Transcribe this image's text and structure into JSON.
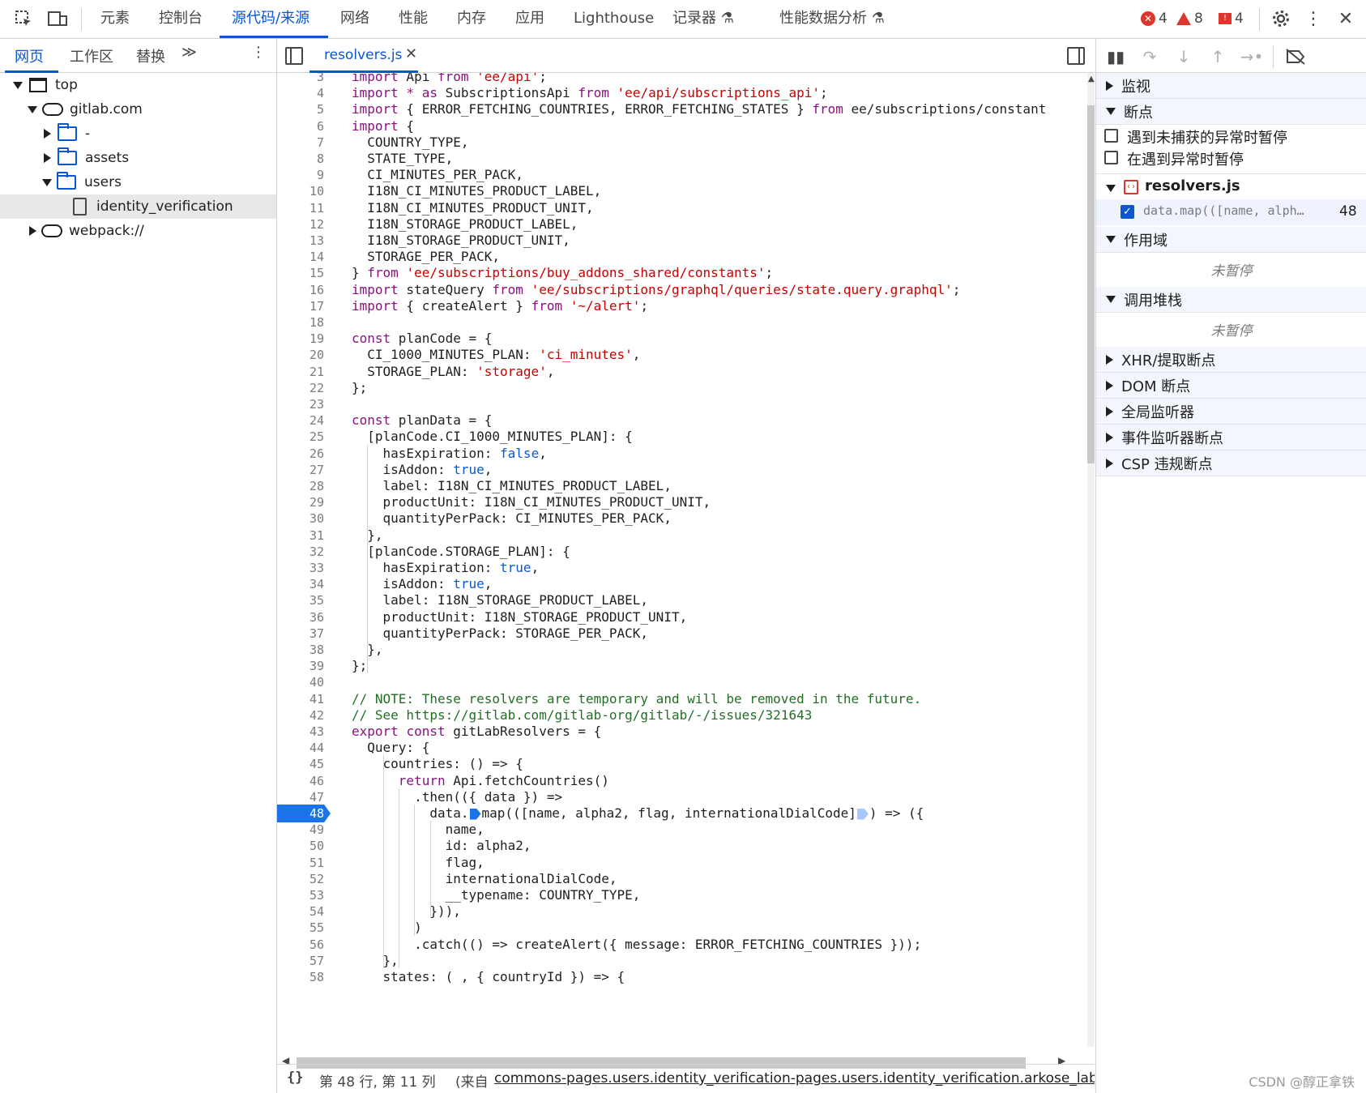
{
  "toolbar": {
    "tabs": [
      "元素",
      "控制台",
      "源代码/来源",
      "网络",
      "性能",
      "内存",
      "应用",
      "Lighthouse",
      "记录器 ⚗",
      "性能数据分析 ⚗"
    ],
    "errors": "4",
    "warnings": "8",
    "issues": "4"
  },
  "navigator": {
    "tabs": [
      "网页",
      "工作区",
      "替换"
    ],
    "tree": [
      "top",
      "gitlab.com",
      "-",
      "assets",
      "users",
      "identity_verification",
      "webpack://"
    ]
  },
  "editor": {
    "file_tab": "resolvers.js",
    "lines": [
      {
        "n": "3",
        "code": "import Api from 'ee/api';"
      },
      {
        "n": "4",
        "code": "import * as SubscriptionsApi from 'ee/api/subscriptions_api';"
      },
      {
        "n": "5",
        "code": "import { ERROR_FETCHING_COUNTRIES, ERROR_FETCHING_STATES } from 'ee/subscriptions/constant"
      },
      {
        "n": "6",
        "code": "import {"
      },
      {
        "n": "7",
        "code": "  COUNTRY_TYPE,"
      },
      {
        "n": "8",
        "code": "  STATE_TYPE,"
      },
      {
        "n": "9",
        "code": "  CI_MINUTES_PER_PACK,"
      },
      {
        "n": "10",
        "code": "  I18N_CI_MINUTES_PRODUCT_LABEL,"
      },
      {
        "n": "11",
        "code": "  I18N_CI_MINUTES_PRODUCT_UNIT,"
      },
      {
        "n": "12",
        "code": "  I18N_STORAGE_PRODUCT_LABEL,"
      },
      {
        "n": "13",
        "code": "  I18N_STORAGE_PRODUCT_UNIT,"
      },
      {
        "n": "14",
        "code": "  STORAGE_PER_PACK,"
      },
      {
        "n": "15",
        "code": "} from 'ee/subscriptions/buy_addons_shared/constants';"
      },
      {
        "n": "16",
        "code": "import stateQuery from 'ee/subscriptions/graphql/queries/state.query.graphql';"
      },
      {
        "n": "17",
        "code": "import { createAlert } from '~/alert';"
      },
      {
        "n": "18",
        "code": ""
      },
      {
        "n": "19",
        "code": "const planCode = {"
      },
      {
        "n": "20",
        "code": "  CI_1000_MINUTES_PLAN: 'ci_minutes',"
      },
      {
        "n": "21",
        "code": "  STORAGE_PLAN: 'storage',"
      },
      {
        "n": "22",
        "code": "};"
      },
      {
        "n": "23",
        "code": ""
      },
      {
        "n": "24",
        "code": "const planData = {"
      },
      {
        "n": "25",
        "code": "  [planCode.CI_1000_MINUTES_PLAN]: {"
      },
      {
        "n": "26",
        "code": "    hasExpiration: false,"
      },
      {
        "n": "27",
        "code": "    isAddon: true,"
      },
      {
        "n": "28",
        "code": "    label: I18N_CI_MINUTES_PRODUCT_LABEL,"
      },
      {
        "n": "29",
        "code": "    productUnit: I18N_CI_MINUTES_PRODUCT_UNIT,"
      },
      {
        "n": "30",
        "code": "    quantityPerPack: CI_MINUTES_PER_PACK,"
      },
      {
        "n": "31",
        "code": "  },"
      },
      {
        "n": "32",
        "code": "  [planCode.STORAGE_PLAN]: {"
      },
      {
        "n": "33",
        "code": "    hasExpiration: true,"
      },
      {
        "n": "34",
        "code": "    isAddon: true,"
      },
      {
        "n": "35",
        "code": "    label: I18N_STORAGE_PRODUCT_LABEL,"
      },
      {
        "n": "36",
        "code": "    productUnit: I18N_STORAGE_PRODUCT_UNIT,"
      },
      {
        "n": "37",
        "code": "    quantityPerPack: STORAGE_PER_PACK,"
      },
      {
        "n": "38",
        "code": "  },"
      },
      {
        "n": "39",
        "code": "};"
      },
      {
        "n": "40",
        "code": ""
      },
      {
        "n": "41",
        "code": "// NOTE: These resolvers are temporary and will be removed in the future."
      },
      {
        "n": "42",
        "code": "// See https://gitlab.com/gitlab-org/gitlab/-/issues/321643"
      },
      {
        "n": "43",
        "code": "export const gitLabResolvers = {"
      },
      {
        "n": "44",
        "code": "  Query: {"
      },
      {
        "n": "45",
        "code": "    countries: () => {"
      },
      {
        "n": "46",
        "code": "      return Api.fetchCountries()"
      },
      {
        "n": "47",
        "code": "        .then(({ data }) =>"
      },
      {
        "n": "48",
        "code": "          data.map(([name, alpha2, flag, internationalDialCode]) => ({"
      },
      {
        "n": "49",
        "code": "            name,"
      },
      {
        "n": "50",
        "code": "            id: alpha2,"
      },
      {
        "n": "51",
        "code": "            flag,"
      },
      {
        "n": "52",
        "code": "            internationalDialCode,"
      },
      {
        "n": "53",
        "code": "            __typename: COUNTRY_TYPE,"
      },
      {
        "n": "54",
        "code": "          })),"
      },
      {
        "n": "55",
        "code": "        )"
      },
      {
        "n": "56",
        "code": "        .catch(() => createAlert({ message: ERROR_FETCHING_COUNTRIES }));"
      },
      {
        "n": "57",
        "code": "    },"
      },
      {
        "n": "58",
        "code": "    states: ( , { countryId }) => {"
      }
    ],
    "breakpoint_line": "48",
    "status_position": "第 48 行, 第 11 列",
    "status_source_prefix": "(来自",
    "status_source_link": "commons-pages.users.identity_verification-pages.users.identity_verification.arkose_labs_chal"
  },
  "debugger": {
    "watch": "监视",
    "breakpoints": "断点",
    "pause_uncaught": "遇到未捕获的异常时暂停",
    "pause_caught": "在遇到异常时暂停",
    "bp_file": "resolvers.js",
    "bp_code": "data.map(([name, alph…",
    "bp_line": "48",
    "scope": "作用域",
    "scope_empty": "未暂停",
    "callstack": "调用堆栈",
    "callstack_empty": "未暂停",
    "xhr": "XHR/提取断点",
    "dom": "DOM 断点",
    "global": "全局监听器",
    "event": "事件监听器断点",
    "csp": "CSP 违规断点"
  },
  "watermark": "CSDN @醇正拿铁"
}
